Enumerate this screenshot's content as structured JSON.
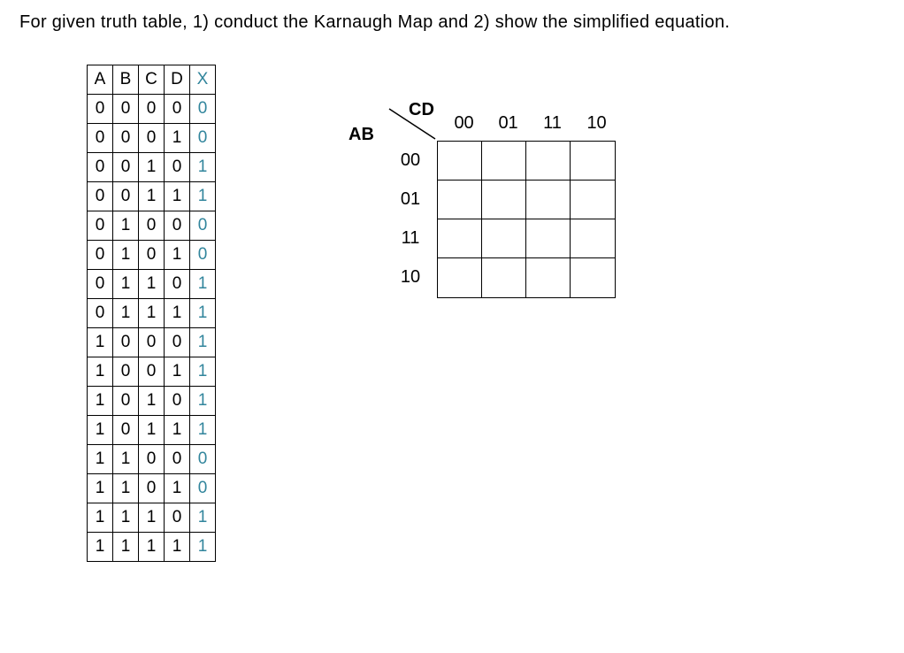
{
  "question": "For given truth table, 1) conduct the Karnaugh Map and 2) show the simplified equation.",
  "truth_table": {
    "headers": [
      "A",
      "B",
      "C",
      "D",
      "X"
    ],
    "rows": [
      [
        "0",
        "0",
        "0",
        "0",
        "0"
      ],
      [
        "0",
        "0",
        "0",
        "1",
        "0"
      ],
      [
        "0",
        "0",
        "1",
        "0",
        "1"
      ],
      [
        "0",
        "0",
        "1",
        "1",
        "1"
      ],
      [
        "0",
        "1",
        "0",
        "0",
        "0"
      ],
      [
        "0",
        "1",
        "0",
        "1",
        "0"
      ],
      [
        "0",
        "1",
        "1",
        "0",
        "1"
      ],
      [
        "0",
        "1",
        "1",
        "1",
        "1"
      ],
      [
        "1",
        "0",
        "0",
        "0",
        "1"
      ],
      [
        "1",
        "0",
        "0",
        "1",
        "1"
      ],
      [
        "1",
        "0",
        "1",
        "0",
        "1"
      ],
      [
        "1",
        "0",
        "1",
        "1",
        "1"
      ],
      [
        "1",
        "1",
        "0",
        "0",
        "0"
      ],
      [
        "1",
        "1",
        "0",
        "1",
        "0"
      ],
      [
        "1",
        "1",
        "1",
        "0",
        "1"
      ],
      [
        "1",
        "1",
        "1",
        "1",
        "1"
      ]
    ],
    "output_color": "#31859c"
  },
  "kmap": {
    "ab_label": "AB",
    "cd_label": "CD",
    "col_headers": [
      "00",
      "01",
      "11",
      "10"
    ],
    "row_headers": [
      "00",
      "01",
      "11",
      "10"
    ],
    "cells": [
      [
        "",
        "",
        "",
        ""
      ],
      [
        "",
        "",
        "",
        ""
      ],
      [
        "",
        "",
        "",
        ""
      ],
      [
        "",
        "",
        "",
        ""
      ]
    ]
  },
  "chart_data": {
    "type": "table",
    "title": "Truth Table and empty Karnaugh Map template",
    "truth_table_inputs": [
      "A",
      "B",
      "C",
      "D"
    ],
    "truth_table_output": "X",
    "truth_table_rows": [
      {
        "A": 0,
        "B": 0,
        "C": 0,
        "D": 0,
        "X": 0
      },
      {
        "A": 0,
        "B": 0,
        "C": 0,
        "D": 1,
        "X": 0
      },
      {
        "A": 0,
        "B": 0,
        "C": 1,
        "D": 0,
        "X": 1
      },
      {
        "A": 0,
        "B": 0,
        "C": 1,
        "D": 1,
        "X": 1
      },
      {
        "A": 0,
        "B": 1,
        "C": 0,
        "D": 0,
        "X": 0
      },
      {
        "A": 0,
        "B": 1,
        "C": 0,
        "D": 1,
        "X": 0
      },
      {
        "A": 0,
        "B": 1,
        "C": 1,
        "D": 0,
        "X": 1
      },
      {
        "A": 0,
        "B": 1,
        "C": 1,
        "D": 1,
        "X": 1
      },
      {
        "A": 1,
        "B": 0,
        "C": 0,
        "D": 0,
        "X": 1
      },
      {
        "A": 1,
        "B": 0,
        "C": 0,
        "D": 1,
        "X": 1
      },
      {
        "A": 1,
        "B": 0,
        "C": 1,
        "D": 0,
        "X": 1
      },
      {
        "A": 1,
        "B": 0,
        "C": 1,
        "D": 1,
        "X": 1
      },
      {
        "A": 1,
        "B": 1,
        "C": 0,
        "D": 0,
        "X": 0
      },
      {
        "A": 1,
        "B": 1,
        "C": 0,
        "D": 1,
        "X": 0
      },
      {
        "A": 1,
        "B": 1,
        "C": 1,
        "D": 0,
        "X": 1
      },
      {
        "A": 1,
        "B": 1,
        "C": 1,
        "D": 1,
        "X": 1
      }
    ],
    "kmap_row_variable": "AB",
    "kmap_col_variable": "CD",
    "kmap_row_order": [
      "00",
      "01",
      "11",
      "10"
    ],
    "kmap_col_order": [
      "00",
      "01",
      "11",
      "10"
    ],
    "kmap_cells_filled": false
  }
}
